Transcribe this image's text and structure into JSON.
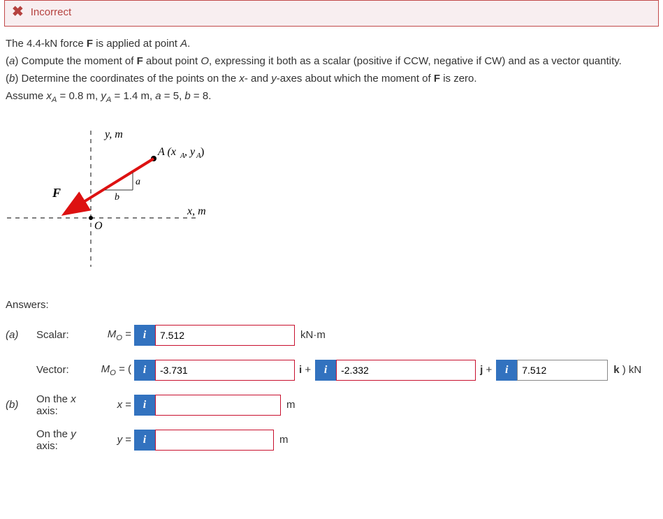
{
  "banner": {
    "icon": "✖",
    "text": "Incorrect"
  },
  "problem": {
    "intro": "The 4.4-kN force F is applied at point A.",
    "part_a": "(a) Compute the moment of F about point O, expressing it both as a scalar (positive if CCW, negative if CW) and as a vector quantity.",
    "part_b": "(b) Determine the coordinates of the points on the x- and y-axes about which the moment of F is zero.",
    "assume_prefix": "Assume ",
    "assume_rest": " = 0.8 m, yA = 1.4 m, a = 5, b = 8."
  },
  "figure": {
    "y_label": "y, m",
    "x_label": "x, m",
    "A_label": "A (xA, yA)",
    "F_label": "F",
    "O_label": "O",
    "a_label": "a",
    "b_label": "b"
  },
  "answers_header": "Answers:",
  "rows": {
    "a_part": "(a)",
    "scalar_label": "Scalar:",
    "scalar_expr": "MO =",
    "scalar_value": "7.512",
    "scalar_unit": "kN·m",
    "vector_label": "Vector:",
    "vector_expr": "MO = (",
    "vector_i_value": "-3.731",
    "vector_ij_sep": "i +",
    "vector_j_value": "-2.332",
    "vector_jk_sep": "j +",
    "vector_k_value": "7.512",
    "vector_unit": "k ) kN",
    "b_part": "(b)",
    "x_axis_label": "On the x axis:",
    "x_expr": "x =",
    "x_value": "",
    "x_unit": "m",
    "y_axis_label": "On the y axis:",
    "y_expr": "y =",
    "y_value": "",
    "y_unit": "m"
  },
  "info_glyph": "i"
}
